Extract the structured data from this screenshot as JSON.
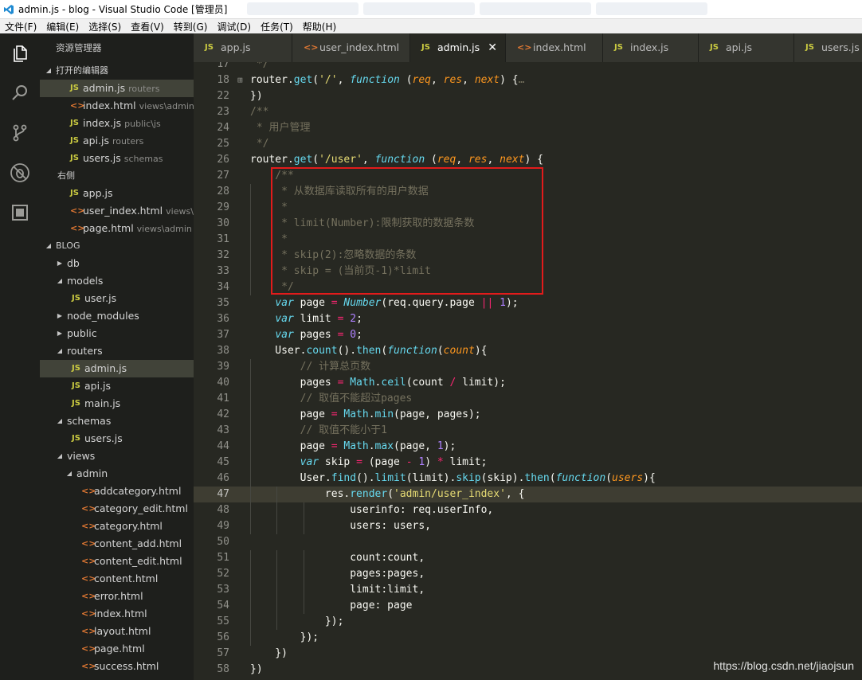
{
  "window": {
    "title": "admin.js - blog - Visual Studio Code [管理员]"
  },
  "menu": [
    "文件(F)",
    "编辑(E)",
    "选择(S)",
    "查看(V)",
    "转到(G)",
    "调试(D)",
    "任务(T)",
    "帮助(H)"
  ],
  "activity_bar": [
    "files-icon",
    "search-icon",
    "source-control-icon",
    "debug-icon",
    "extensions-icon"
  ],
  "sidebar": {
    "header": "资源管理器",
    "open_editors_title": "打开的编辑器",
    "open_editors": [
      {
        "type": "js",
        "name": "admin.js",
        "desc": "routers",
        "selected": true
      },
      {
        "type": "html",
        "name": "index.html",
        "desc": "views\\admin"
      },
      {
        "type": "js",
        "name": "index.js",
        "desc": "public\\js"
      },
      {
        "type": "js",
        "name": "api.js",
        "desc": "routers"
      },
      {
        "type": "js",
        "name": "users.js",
        "desc": "schemas"
      }
    ],
    "group_right_title": "右侧",
    "group_right": [
      {
        "type": "js",
        "name": "app.js",
        "desc": ""
      },
      {
        "type": "html",
        "name": "user_index.html",
        "desc": "views\\..."
      },
      {
        "type": "html",
        "name": "page.html",
        "desc": "views\\admin"
      }
    ],
    "workspace_title": "BLOG",
    "tree": [
      {
        "kind": "folder",
        "name": "db",
        "depth": 0,
        "open": false
      },
      {
        "kind": "folder",
        "name": "models",
        "depth": 0,
        "open": true
      },
      {
        "kind": "js",
        "name": "user.js",
        "depth": 1
      },
      {
        "kind": "folder",
        "name": "node_modules",
        "depth": 0,
        "open": false
      },
      {
        "kind": "folder",
        "name": "public",
        "depth": 0,
        "open": false
      },
      {
        "kind": "folder",
        "name": "routers",
        "depth": 0,
        "open": true
      },
      {
        "kind": "js",
        "name": "admin.js",
        "depth": 1,
        "selected": true
      },
      {
        "kind": "js",
        "name": "api.js",
        "depth": 1
      },
      {
        "kind": "js",
        "name": "main.js",
        "depth": 1
      },
      {
        "kind": "folder",
        "name": "schemas",
        "depth": 0,
        "open": true
      },
      {
        "kind": "js",
        "name": "users.js",
        "depth": 1
      },
      {
        "kind": "folder",
        "name": "views",
        "depth": 0,
        "open": true
      },
      {
        "kind": "folder",
        "name": "admin",
        "depth": 1,
        "open": true
      },
      {
        "kind": "html",
        "name": "addcategory.html",
        "depth": 2
      },
      {
        "kind": "html",
        "name": "category_edit.html",
        "depth": 2
      },
      {
        "kind": "html",
        "name": "category.html",
        "depth": 2
      },
      {
        "kind": "html",
        "name": "content_add.html",
        "depth": 2
      },
      {
        "kind": "html",
        "name": "content_edit.html",
        "depth": 2
      },
      {
        "kind": "html",
        "name": "content.html",
        "depth": 2
      },
      {
        "kind": "html",
        "name": "error.html",
        "depth": 2
      },
      {
        "kind": "html",
        "name": "index.html",
        "depth": 2
      },
      {
        "kind": "html",
        "name": "layout.html",
        "depth": 2
      },
      {
        "kind": "html",
        "name": "page.html",
        "depth": 2
      },
      {
        "kind": "html",
        "name": "success.html",
        "depth": 2
      }
    ]
  },
  "tabs": [
    {
      "type": "js",
      "name": "app.js",
      "active": false
    },
    {
      "type": "html",
      "name": "user_index.html",
      "active": false
    },
    {
      "type": "js",
      "name": "admin.js",
      "active": true
    },
    {
      "type": "html",
      "name": "index.html",
      "active": false
    },
    {
      "type": "js",
      "name": "index.js",
      "active": false
    },
    {
      "type": "js",
      "name": "api.js",
      "active": false
    },
    {
      "type": "js",
      "name": "users.js",
      "active": false
    }
  ],
  "editor": {
    "current_line": 47,
    "lines": [
      {
        "n": 17,
        "t": [
          [
            "c",
            " */"
          ]
        ]
      },
      {
        "n": 18,
        "fold": true,
        "t": [
          [
            "",
            "router."
          ],
          [
            "f",
            "get"
          ],
          [
            "",
            "("
          ],
          [
            "s",
            "'/'"
          ],
          [
            "",
            ", "
          ],
          [
            "k",
            "function"
          ],
          [
            "",
            " ("
          ],
          [
            "p",
            "req"
          ],
          [
            "",
            ", "
          ],
          [
            "p",
            "res"
          ],
          [
            "",
            ", "
          ],
          [
            "p",
            "next"
          ],
          [
            "",
            ") {"
          ],
          [
            "c",
            "…"
          ]
        ]
      },
      {
        "n": 22,
        "t": [
          [
            "",
            "})"
          ]
        ]
      },
      {
        "n": 23,
        "t": [
          [
            "c",
            "/**"
          ]
        ]
      },
      {
        "n": 24,
        "t": [
          [
            "c",
            " * 用户管理"
          ]
        ]
      },
      {
        "n": 25,
        "t": [
          [
            "c",
            " */"
          ]
        ]
      },
      {
        "n": 26,
        "t": [
          [
            "",
            "router."
          ],
          [
            "f",
            "get"
          ],
          [
            "",
            "("
          ],
          [
            "s",
            "'/user'"
          ],
          [
            "",
            ", "
          ],
          [
            "k",
            "function"
          ],
          [
            "",
            " ("
          ],
          [
            "p",
            "req"
          ],
          [
            "",
            ", "
          ],
          [
            "p",
            "res"
          ],
          [
            "",
            ", "
          ],
          [
            "p",
            "next"
          ],
          [
            "",
            ") {"
          ]
        ]
      },
      {
        "n": 27,
        "t": [
          [
            "c",
            "    /**"
          ]
        ]
      },
      {
        "n": 28,
        "t": [
          [
            "c",
            "     * 从数据库读取所有的用户数据"
          ]
        ]
      },
      {
        "n": 29,
        "t": [
          [
            "c",
            "     *"
          ]
        ]
      },
      {
        "n": 30,
        "t": [
          [
            "c",
            "     * limit(Number):限制获取的数据条数"
          ]
        ]
      },
      {
        "n": 31,
        "t": [
          [
            "c",
            "     *"
          ]
        ]
      },
      {
        "n": 32,
        "t": [
          [
            "c",
            "     * skip(2):忽略数据的条数"
          ]
        ]
      },
      {
        "n": 33,
        "t": [
          [
            "c",
            "     * skip = (当前页-1)*limit"
          ]
        ]
      },
      {
        "n": 34,
        "t": [
          [
            "c",
            "     */"
          ]
        ]
      },
      {
        "n": 35,
        "t": [
          [
            "",
            "    "
          ],
          [
            "k",
            "var"
          ],
          [
            "",
            " page "
          ],
          [
            "o",
            "="
          ],
          [
            "",
            " "
          ],
          [
            "k",
            "Number"
          ],
          [
            "",
            "(req.query.page "
          ],
          [
            "o",
            "||"
          ],
          [
            "",
            " "
          ],
          [
            "n",
            "1"
          ],
          [
            "",
            ");"
          ]
        ]
      },
      {
        "n": 36,
        "t": [
          [
            "",
            "    "
          ],
          [
            "k",
            "var"
          ],
          [
            "",
            " limit "
          ],
          [
            "o",
            "="
          ],
          [
            "",
            " "
          ],
          [
            "n",
            "2"
          ],
          [
            "",
            ";"
          ]
        ]
      },
      {
        "n": 37,
        "t": [
          [
            "",
            "    "
          ],
          [
            "k",
            "var"
          ],
          [
            "",
            " pages "
          ],
          [
            "o",
            "="
          ],
          [
            "",
            " "
          ],
          [
            "n",
            "0"
          ],
          [
            "",
            ";"
          ]
        ]
      },
      {
        "n": 38,
        "t": [
          [
            "",
            "    User."
          ],
          [
            "f",
            "count"
          ],
          [
            "",
            "()."
          ],
          [
            "f",
            "then"
          ],
          [
            "",
            "("
          ],
          [
            "k",
            "function"
          ],
          [
            "",
            "("
          ],
          [
            "p",
            "count"
          ],
          [
            "",
            "){"
          ]
        ]
      },
      {
        "n": 39,
        "t": [
          [
            "c",
            "        // 计算总页数"
          ]
        ]
      },
      {
        "n": 40,
        "t": [
          [
            "",
            "        pages "
          ],
          [
            "o",
            "="
          ],
          [
            "",
            " "
          ],
          [
            "f",
            "Math"
          ],
          [
            "",
            "."
          ],
          [
            "f",
            "ceil"
          ],
          [
            "",
            "(count "
          ],
          [
            "o",
            "/"
          ],
          [
            "",
            " limit);"
          ]
        ]
      },
      {
        "n": 41,
        "t": [
          [
            "c",
            "        // 取值不能超过pages"
          ]
        ]
      },
      {
        "n": 42,
        "t": [
          [
            "",
            "        page "
          ],
          [
            "o",
            "="
          ],
          [
            "",
            " "
          ],
          [
            "f",
            "Math"
          ],
          [
            "",
            "."
          ],
          [
            "f",
            "min"
          ],
          [
            "",
            "(page, pages);"
          ]
        ]
      },
      {
        "n": 43,
        "t": [
          [
            "c",
            "        // 取值不能小于1"
          ]
        ]
      },
      {
        "n": 44,
        "t": [
          [
            "",
            "        page "
          ],
          [
            "o",
            "="
          ],
          [
            "",
            " "
          ],
          [
            "f",
            "Math"
          ],
          [
            "",
            "."
          ],
          [
            "f",
            "max"
          ],
          [
            "",
            "(page, "
          ],
          [
            "n",
            "1"
          ],
          [
            "",
            ");"
          ]
        ]
      },
      {
        "n": 45,
        "t": [
          [
            "",
            "        "
          ],
          [
            "k",
            "var"
          ],
          [
            "",
            " skip "
          ],
          [
            "o",
            "="
          ],
          [
            "",
            " (page "
          ],
          [
            "o",
            "-"
          ],
          [
            "",
            " "
          ],
          [
            "n",
            "1"
          ],
          [
            "",
            ") "
          ],
          [
            "o",
            "*"
          ],
          [
            "",
            " limit;"
          ]
        ]
      },
      {
        "n": 46,
        "t": [
          [
            "",
            "        User."
          ],
          [
            "f",
            "find"
          ],
          [
            "",
            "()."
          ],
          [
            "f",
            "limit"
          ],
          [
            "",
            "(limit)."
          ],
          [
            "f",
            "skip"
          ],
          [
            "",
            "(skip)."
          ],
          [
            "f",
            "then"
          ],
          [
            "",
            "("
          ],
          [
            "k",
            "function"
          ],
          [
            "",
            "("
          ],
          [
            "p",
            "users"
          ],
          [
            "",
            "){"
          ]
        ]
      },
      {
        "n": 47,
        "t": [
          [
            "",
            "            res."
          ],
          [
            "f",
            "render"
          ],
          [
            "",
            "("
          ],
          [
            "s",
            "'admin/user_index'"
          ],
          [
            "",
            ", {"
          ]
        ]
      },
      {
        "n": 48,
        "t": [
          [
            "",
            "                userinfo: req.userInfo,"
          ]
        ]
      },
      {
        "n": 49,
        "t": [
          [
            "",
            "                users: users,"
          ]
        ]
      },
      {
        "n": 50,
        "t": [
          [
            "",
            ""
          ]
        ]
      },
      {
        "n": 51,
        "t": [
          [
            "",
            "                count:count,"
          ]
        ]
      },
      {
        "n": 52,
        "t": [
          [
            "",
            "                pages:pages,"
          ]
        ]
      },
      {
        "n": 53,
        "t": [
          [
            "",
            "                limit:limit,"
          ]
        ]
      },
      {
        "n": 54,
        "t": [
          [
            "",
            "                page: page"
          ]
        ]
      },
      {
        "n": 55,
        "t": [
          [
            "",
            "            });"
          ]
        ]
      },
      {
        "n": 56,
        "t": [
          [
            "",
            "        });"
          ]
        ]
      },
      {
        "n": 57,
        "t": [
          [
            "",
            "    })"
          ]
        ]
      },
      {
        "n": 58,
        "t": [
          [
            "",
            "})"
          ]
        ]
      }
    ]
  },
  "watermark": "https://blog.csdn.net/jiaojsun",
  "colors": {
    "editor_bg": "#272822",
    "sidebar_bg": "#1e1f1c",
    "keyword": "#66d9ef",
    "string": "#e6db74",
    "param": "#fd971f",
    "operator": "#f92672",
    "number": "#ae81ff",
    "comment": "#75715e",
    "highlight_box": "#e21b1b"
  }
}
